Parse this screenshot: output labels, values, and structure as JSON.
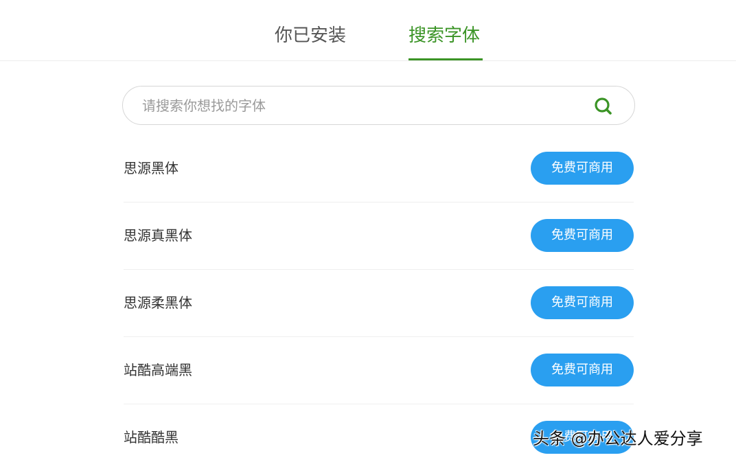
{
  "tabs": [
    {
      "label": "你已安装",
      "active": false
    },
    {
      "label": "搜索字体",
      "active": true
    }
  ],
  "search": {
    "placeholder": "请搜索你想找的字体",
    "value": ""
  },
  "fonts": [
    {
      "name": "思源黑体",
      "license": "免费可商用"
    },
    {
      "name": "思源真黑体",
      "license": "免费可商用"
    },
    {
      "name": "思源柔黑体",
      "license": "免费可商用"
    },
    {
      "name": "站酷高端黑",
      "license": "免费可商用"
    },
    {
      "name": "站酷酷黑",
      "license": "免费可商用"
    }
  ],
  "watermark": "头条 @办公达人爱分享",
  "colors": {
    "accent": "#3b9426",
    "button": "#2a9ff0",
    "tab_inactive": "#555555"
  }
}
